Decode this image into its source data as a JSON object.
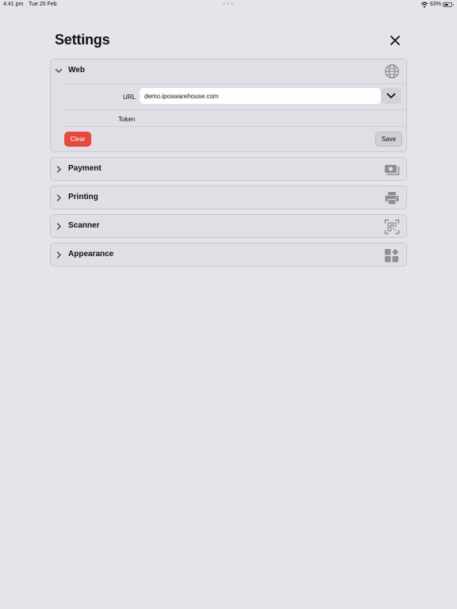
{
  "status_bar": {
    "time": "4:41 pm",
    "date": "Tue 20 Feb",
    "battery_percent": "63%",
    "battery_level": 0.63,
    "icons": [
      "wifi-icon",
      "battery-icon"
    ]
  },
  "header": {
    "title": "Settings",
    "close_icon": "close-icon"
  },
  "sections": [
    {
      "label": "Web",
      "expanded": true,
      "icon": "globe-icon",
      "fields": {
        "url_label": "URL",
        "url_value": "demo.iposwarehouse.com",
        "token_label": "Token",
        "token_value": ""
      },
      "clear_label": "Clear",
      "save_label": "Save"
    },
    {
      "label": "Payment",
      "expanded": false,
      "icon": "cash-icon"
    },
    {
      "label": "Printing",
      "expanded": false,
      "icon": "printer-icon"
    },
    {
      "label": "Scanner",
      "expanded": false,
      "icon": "qr-scanner-icon"
    },
    {
      "label": "Appearance",
      "expanded": false,
      "icon": "widgets-icon"
    }
  ],
  "colors": {
    "background": "#e5e4ea",
    "section_bg": "#e0dfe5",
    "clear_button": "#e9483c",
    "icon_gray": "#8e8e93"
  }
}
